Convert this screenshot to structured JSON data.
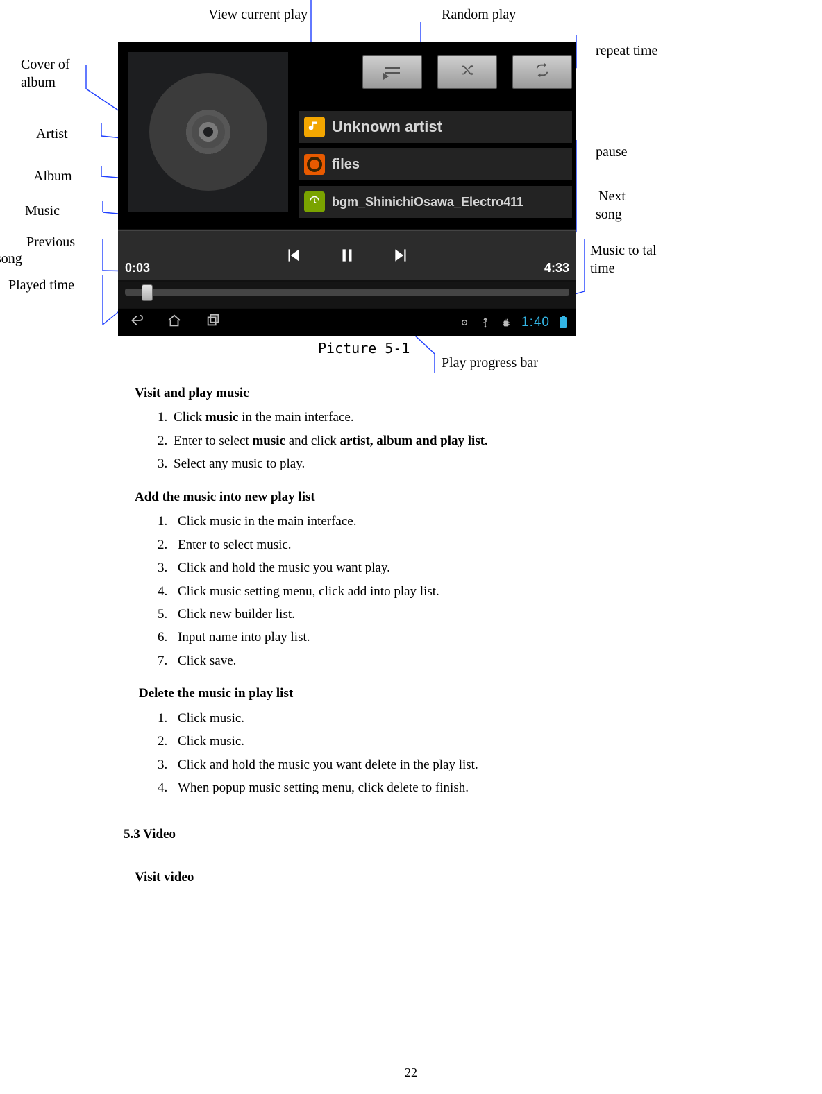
{
  "annotations": {
    "view_current_play": "View current   play",
    "random_play": "Random play",
    "repeat_time": "repeat time",
    "cover_of_album_l1": "Cover of",
    "cover_of_album_l2": "album",
    "artist": "Artist",
    "album": "Album",
    "music": "Music",
    "previous": "Previous",
    "song_below_previous": "song",
    "played_time": "Played time",
    "pause": "pause",
    "next": "Next",
    "song_below_next": "song",
    "music_total_l1": "Music to    tal",
    "music_total_l2": "time",
    "play_progress_bar": "Play progress bar"
  },
  "player": {
    "artist": "Unknown artist",
    "album": "files",
    "track": "bgm_ShinichiOsawa_Electro411",
    "elapsed": "0:03",
    "total": "4:33",
    "clock": "1:40"
  },
  "caption": "Picture 5-1",
  "sections": {
    "visit_play": {
      "heading": "Visit and play music",
      "items_html": [
        "Click <b>music</b> in the main interface.",
        "Enter to select <b>music</b> and click <b>artist, album and play list.</b>",
        "Select any music to play."
      ]
    },
    "add_list": {
      "heading": "Add the music into new play list",
      "items": [
        "Click music in the main interface.",
        "Enter to select music.",
        "Click and hold the music you want play.",
        "Click music setting menu, click add into play list.",
        "Click new builder list.",
        "Input name into play list.",
        "Click save."
      ]
    },
    "delete_list": {
      "heading": "Delete the music in play list",
      "items": [
        "Click music.",
        "Click music.",
        "Click and hold the music you want delete in the play list.",
        "When popup music setting menu, click delete to finish."
      ]
    },
    "video_head": "5.3 Video",
    "visit_video": "Visit video"
  },
  "page_number": "22"
}
